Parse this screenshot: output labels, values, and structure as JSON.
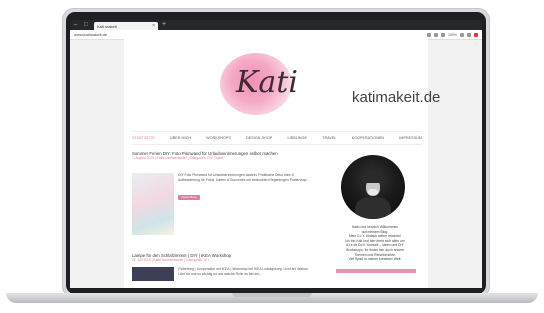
{
  "browser": {
    "window_controls": [
      "–",
      "□"
    ],
    "tab": {
      "title": "Kati makeit",
      "close": "×"
    },
    "new_tab": "+",
    "url": "www.katimakeit.de",
    "zoom": "100%"
  },
  "site": {
    "logo_script": "Kati",
    "brand": "katimakeit.de",
    "nav": [
      "STARTSEITE",
      "ÜBER MICH",
      "WORKSHOPS",
      "DESIGN-SHOP",
      "LIEBLINGE",
      "TRAVEL",
      "KOOPERATIONEN",
      "IMPRESSUM"
    ],
    "nav_active_index": 0
  },
  "posts": [
    {
      "title": "Sommer Ferien DIY: Foto Pinnwand für Urlaubserinnerungen selber machen",
      "meta": "1. August 2019 | Kathi Kammerlander | Categories: DIY, Travel",
      "excerpt": "DIY Foto Pinnwand für Urlaubserinnerungen basteln. Praktische Deko Idee & Aufbewahrung für Fotos, Karten & Souvenirs mit bedruckten Regenbogen Plottervinyl...",
      "button": "Read More"
    },
    {
      "title": "Lampe für den Schlafzimmer | DIY | IKEA Workshop",
      "meta": "21. Juli 2019 | Kathi Kammerlander | Categories: DIY",
      "excerpt": "(*Werbung | Kooperation mit IKEA.) Workshop bei IKEA Ludwigsburg. Licht an! Warum Licht für uns so wichtig ist und welche Rolle es bei der..."
    }
  ],
  "sidebar": {
    "about_lines": [
      "Hallo und herzlich Willkommen",
      "auf meinem Blog.",
      "Mein D.I.Y. einfach selber machen!",
      "Ich bin Kati und hier dreht sich alles um",
      "d.i.e.ch Do It Yourself – Ideen und DIY",
      "Workshops. Ihr findet hier auch andere",
      "Themen und Reiseberichte.",
      "Viel Spaß in meiner kreativen Welt."
    ]
  },
  "colors": {
    "accent": "#e07aa3",
    "bar": "#ee8fb3"
  }
}
